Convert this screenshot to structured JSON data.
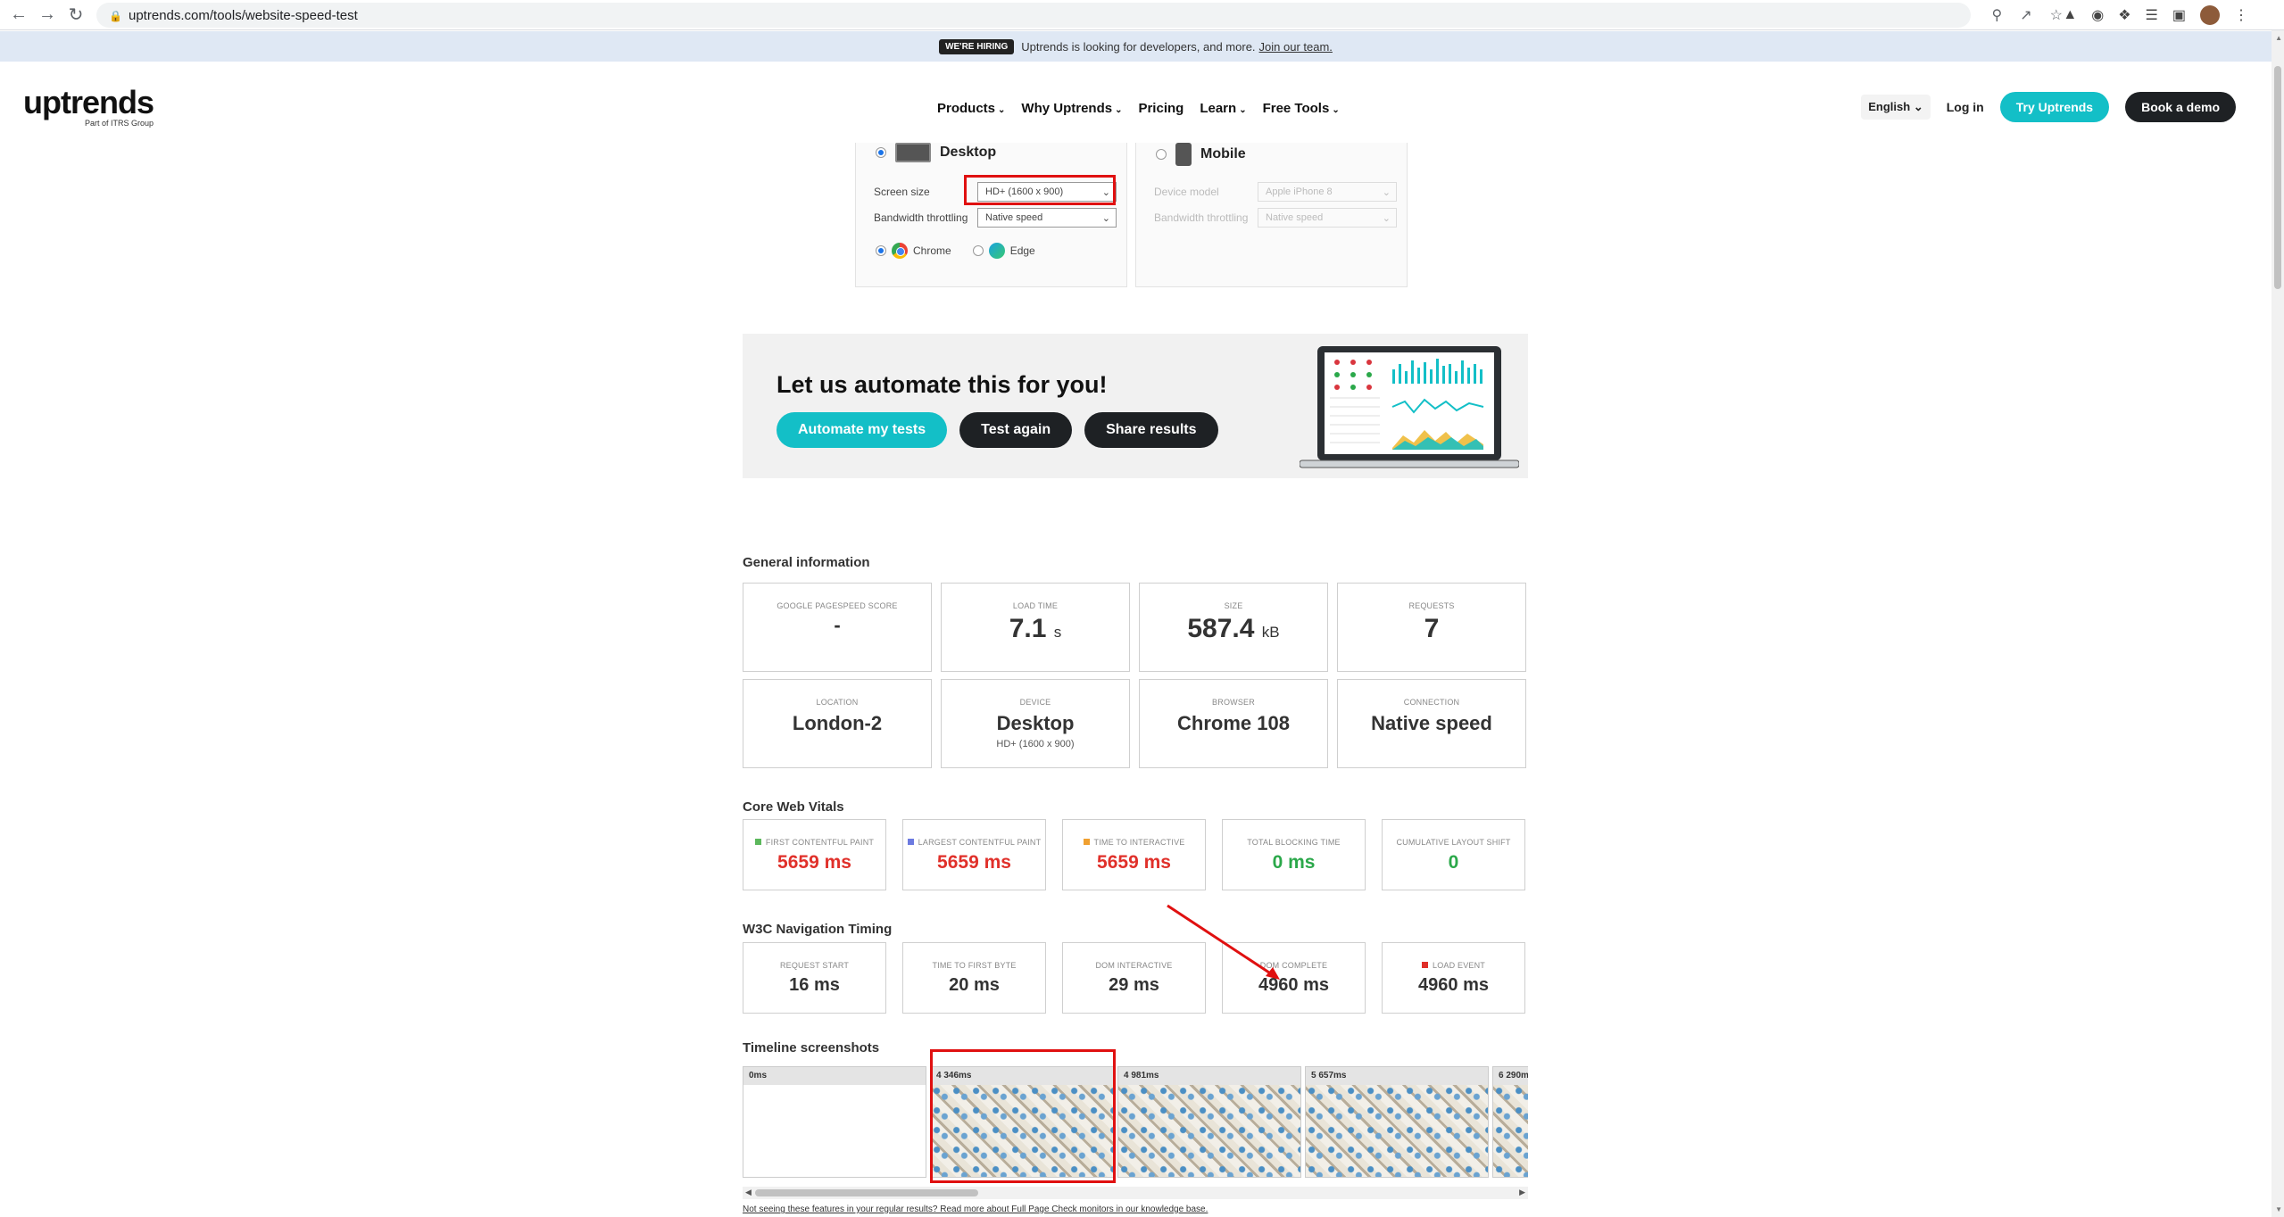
{
  "browser": {
    "url": "uptrends.com/tools/website-speed-test"
  },
  "banner": {
    "tag": "WE'RE HIRING",
    "text": "Uptrends is looking for developers, and more.",
    "link": "Join our team."
  },
  "header": {
    "logo": "uptrends",
    "logo_sub": "Part of ITRS Group",
    "nav": [
      "Products",
      "Why Uptrends",
      "Pricing",
      "Learn",
      "Free Tools"
    ],
    "language": "English",
    "login": "Log in",
    "try": "Try Uptrends",
    "demo": "Book a demo"
  },
  "settings": {
    "desktop": {
      "label": "Desktop",
      "screen_size_label": "Screen size",
      "screen_size_value": "HD+ (1600 x 900)",
      "bandwidth_label": "Bandwidth throttling",
      "bandwidth_value": "Native speed",
      "browser_chrome": "Chrome",
      "browser_edge": "Edge"
    },
    "mobile": {
      "label": "Mobile",
      "device_label": "Device model",
      "device_value": "Apple iPhone 8",
      "bandwidth_label": "Bandwidth throttling",
      "bandwidth_value": "Native speed"
    }
  },
  "automate": {
    "title": "Let us automate this for you!",
    "btn_automate": "Automate my tests",
    "btn_test": "Test again",
    "btn_share": "Share results"
  },
  "general": {
    "title": "General information",
    "pagespeed_label": "GOOGLE PAGESPEED SCORE",
    "pagespeed_value": "-",
    "load_label": "LOAD TIME",
    "load_value": "7.1",
    "load_unit": "s",
    "size_label": "SIZE",
    "size_value": "587.4",
    "size_unit": "kB",
    "requests_label": "REQUESTS",
    "requests_value": "7",
    "location_label": "LOCATION",
    "location_value": "London-2",
    "device_label": "DEVICE",
    "device_value": "Desktop",
    "device_sub": "HD+ (1600 x 900)",
    "browser_label": "BROWSER",
    "browser_value": "Chrome 108",
    "connection_label": "CONNECTION",
    "connection_value": "Native speed"
  },
  "cwv": {
    "title": "Core Web Vitals",
    "items": [
      {
        "label": "FIRST CONTENTFUL PAINT",
        "value": "5659 ms",
        "color": "#5cb85c"
      },
      {
        "label": "LARGEST CONTENTFUL PAINT",
        "value": "5659 ms",
        "color": "#6c7ae0"
      },
      {
        "label": "TIME TO INTERACTIVE",
        "value": "5659 ms",
        "color": "#f0a030"
      },
      {
        "label": "TOTAL BLOCKING TIME",
        "value": "0 ms",
        "color": ""
      },
      {
        "label": "CUMULATIVE LAYOUT SHIFT",
        "value": "0",
        "color": ""
      }
    ]
  },
  "w3c": {
    "title": "W3C Navigation Timing",
    "items": [
      {
        "label": "REQUEST START",
        "value": "16 ms"
      },
      {
        "label": "TIME TO FIRST BYTE",
        "value": "20 ms"
      },
      {
        "label": "DOM INTERACTIVE",
        "value": "29 ms"
      },
      {
        "label": "DOM COMPLETE",
        "value": "4960 ms"
      },
      {
        "label": "LOAD EVENT",
        "value": "4960 ms",
        "color": "#e0302a"
      }
    ]
  },
  "timeline": {
    "title": "Timeline screenshots",
    "frames": [
      "0ms",
      "4 346ms",
      "4 981ms",
      "5 657ms",
      "6 290m"
    ]
  },
  "footnote": "Not seeing these features in your regular results? Read more about Full Page Check monitors in our knowledge base."
}
